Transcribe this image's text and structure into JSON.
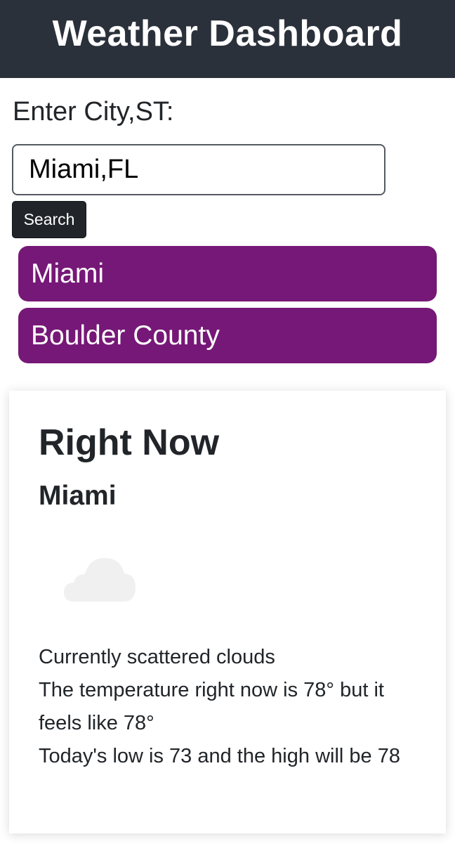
{
  "header": {
    "title": "Weather Dashboard"
  },
  "search": {
    "label": "Enter City,ST:",
    "value": "Miami,FL",
    "button_label": "Search"
  },
  "history": {
    "items": [
      {
        "label": "Miami"
      },
      {
        "label": "Boulder County"
      }
    ]
  },
  "current": {
    "title": "Right Now",
    "city": "Miami",
    "icon": "cloud-icon",
    "condition": "Currently scattered clouds",
    "temperature_line": "The temperature right now is 78° but it feels like 78°",
    "range_line": "Today's low is 73 and the high will be 78"
  },
  "colors": {
    "header_bg": "#2b313b",
    "history_button": "#761877",
    "search_button": "#212529"
  }
}
